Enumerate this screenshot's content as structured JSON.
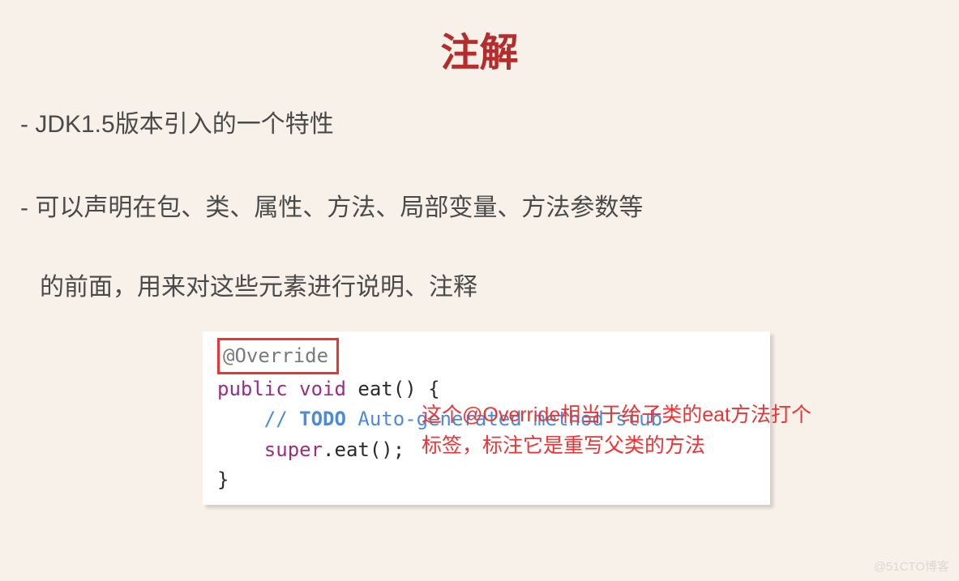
{
  "title": "注解",
  "bullets": {
    "item1": "- JDK1.5版本引入的一个特性",
    "item2": "- 可以声明在包、类、属性、方法、局部变量、方法参数等",
    "item2_cont": "的前面，用来对这些元素进行说明、注释"
  },
  "code": {
    "override": "@Override",
    "line2_public": "public",
    "line2_void": "void",
    "line2_method": " eat",
    "line2_paren": "()",
    "line2_brace": " {",
    "line3_slash": "//",
    "line3_todo": " TODO",
    "line3_text": " Auto-generated method stub",
    "line4_super": "super",
    "line4_call": ".eat();",
    "line5": "}"
  },
  "annotation": {
    "line1": "这个@Override相当于给子类的eat方法打个",
    "line2": "标签，标注它是重写父类的方法"
  },
  "watermark": "@51CTO博客"
}
